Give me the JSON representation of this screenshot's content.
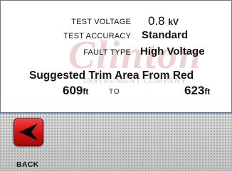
{
  "readings": {
    "test_voltage": {
      "label": "TEST VOLTAGE",
      "value": "0.8",
      "unit": "kV"
    },
    "test_accuracy": {
      "label": "TEST ACCURACY",
      "value": "Standard"
    },
    "fault_type": {
      "label": "FAULT TYPE",
      "value": "High Voltage"
    }
  },
  "watermark": {
    "logo_text": "Clinton",
    "company_text": "INSTRUMENT COMPANY"
  },
  "trim_area": {
    "title": "Suggested Trim Area From Red",
    "from_value": "609",
    "from_unit": "ft",
    "to_word": "TO",
    "to_value": "623",
    "to_unit": "ft"
  },
  "nav": {
    "back_label": "BACK",
    "back_icon": "arrow-left-icon"
  },
  "colors": {
    "back_button": "#d01414",
    "bar_border": "#6a7fa8"
  }
}
